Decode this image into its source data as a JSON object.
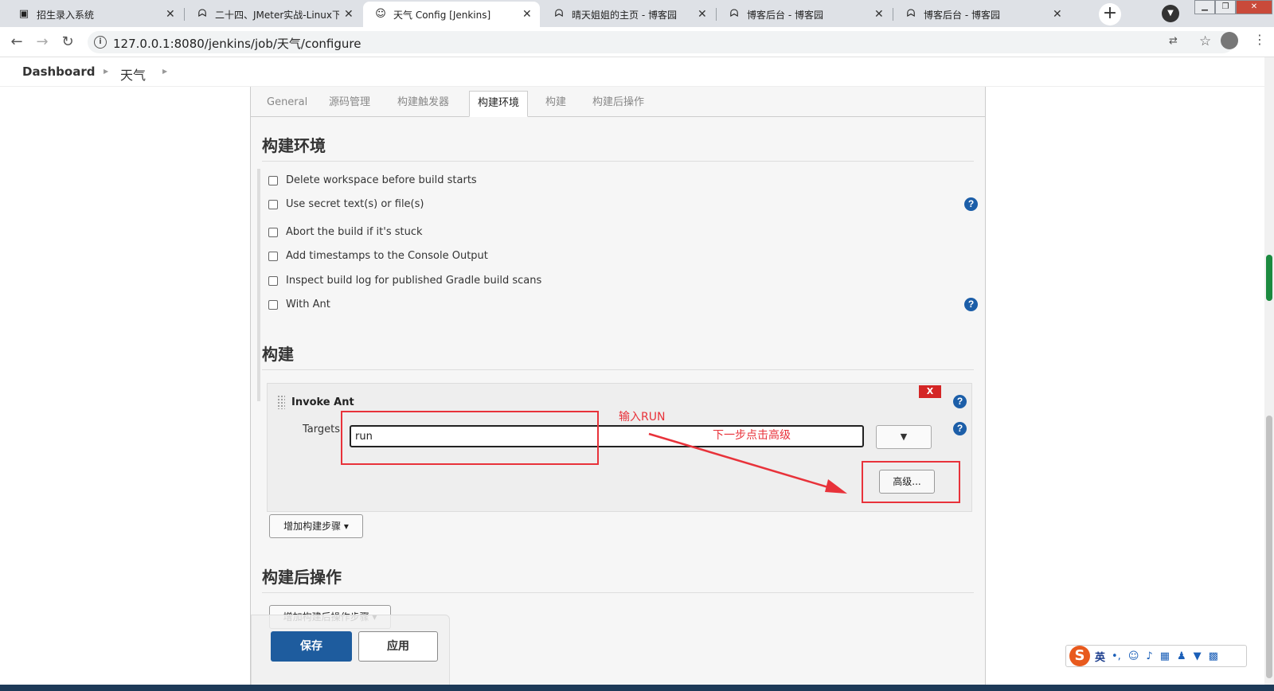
{
  "browser": {
    "tabs": [
      {
        "label": "招生录入系统",
        "icon": "page-icon",
        "active": false
      },
      {
        "label": "二十四、JMeter实战-Linux下",
        "icon": "cnblogs-icon",
        "active": false
      },
      {
        "label": "天气 Config [Jenkins]",
        "icon": "jenkins-icon",
        "active": true
      },
      {
        "label": "晴天姐姐的主页 - 博客园",
        "icon": "cnblogs-icon",
        "active": false
      },
      {
        "label": "博客后台 - 博客园",
        "icon": "cnblogs-icon",
        "active": false
      },
      {
        "label": "博客后台 - 博客园",
        "icon": "cnblogs-icon",
        "active": false
      }
    ],
    "url": "127.0.0.1:8080/jenkins/job/天气/configure",
    "new_tab": "+"
  },
  "breadcrumb": {
    "dashboard": "Dashboard",
    "job": "天气"
  },
  "config_tabs": [
    "General",
    "源码管理",
    "构建触发器",
    "构建环境",
    "构建",
    "构建后操作"
  ],
  "build_env": {
    "heading": "构建环境",
    "options": [
      "Delete workspace before build starts",
      "Use secret text(s) or file(s)",
      "Abort the build if it's stuck",
      "Add timestamps to the Console Output",
      "Inspect build log for published Gradle build scans",
      "With Ant"
    ]
  },
  "build": {
    "heading": "构建",
    "step_title": "Invoke Ant",
    "delete_label": "X",
    "targets_label": "Targets",
    "targets_value": "run",
    "expand_label": "▼",
    "advanced_label": "高级...",
    "add_step_label": "增加构建步骤 ▾"
  },
  "post_build": {
    "heading": "构建后操作",
    "add_label": "增加构建后操作步骤 ▾"
  },
  "actions": {
    "save": "保存",
    "apply": "应用"
  },
  "annotations": {
    "input_hint": "输入RUN",
    "next_hint": "下一步点击高级"
  },
  "ime": {
    "logo": "S",
    "lang": "英"
  },
  "colors": {
    "accent": "#1e5c9e",
    "annotation": "#e8323a",
    "delete": "#d42525",
    "help": "#1c5ea8"
  }
}
